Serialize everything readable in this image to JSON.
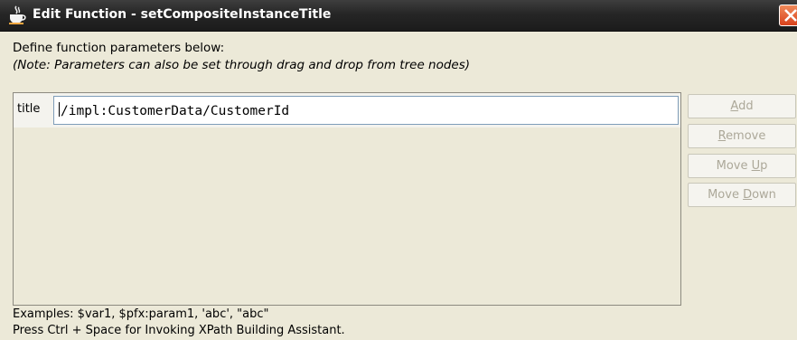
{
  "window": {
    "title": "Edit Function - setCompositeInstanceTitle",
    "icon": "java-cup-icon"
  },
  "instructions": {
    "line1": "Define function parameters below:",
    "note": "(Note: Parameters can also be set through drag and drop from tree nodes)"
  },
  "parameters": [
    {
      "name": "title",
      "value": "/impl:CustomerData/CustomerId"
    }
  ],
  "buttons": {
    "add": {
      "pre": "",
      "mnemonic": "A",
      "post": "dd",
      "enabled": false
    },
    "remove": {
      "pre": "",
      "mnemonic": "R",
      "post": "emove",
      "enabled": false
    },
    "move_up": {
      "pre": "Move ",
      "mnemonic": "U",
      "post": "p",
      "enabled": false
    },
    "move_down": {
      "pre": "Move ",
      "mnemonic": "D",
      "post": "own",
      "enabled": false
    }
  },
  "footer": {
    "examples": "Examples: $var1, $pfx:param1, 'abc', \"abc\"",
    "hint": "Press Ctrl + Space for Invoking XPath Building Assistant."
  },
  "colors": {
    "titlebar": "#262626",
    "dialog_bg": "#ece9d8",
    "close_button": "#d9421c",
    "disabled_text": "#aca899"
  }
}
